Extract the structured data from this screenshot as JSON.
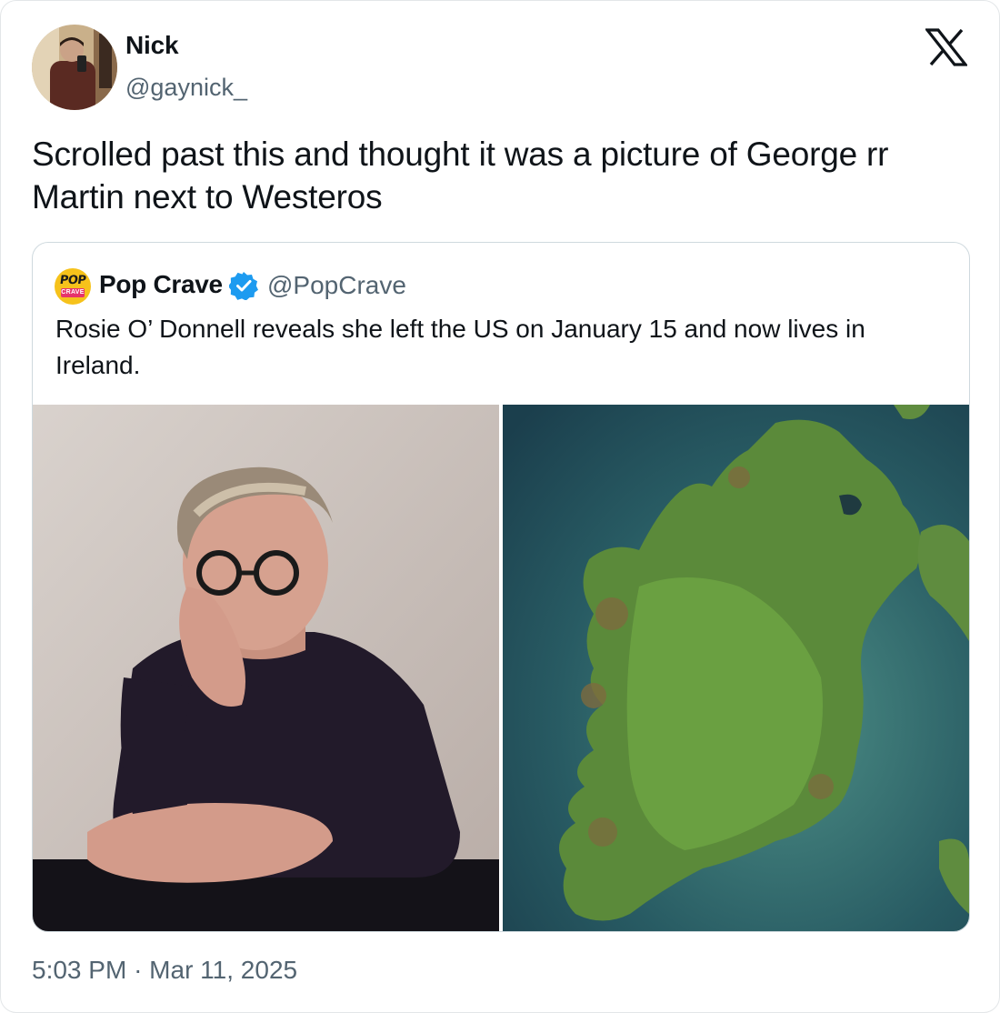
{
  "tweet": {
    "author": {
      "display_name": "Nick",
      "handle": "@gaynick_",
      "avatar_icon": "user-avatar-photo"
    },
    "platform_icon": "x-logo-icon",
    "text": "Scrolled past this and thought it was a picture of George rr Martin next to Westeros",
    "time": "5:03 PM",
    "separator": "·",
    "date": "Mar 11, 2025"
  },
  "quote": {
    "author": {
      "display_name": "Pop Crave",
      "handle": "@PopCrave",
      "verified": true,
      "avatar_logo_text_top": "POP",
      "avatar_logo_text_bottom": "CRAVE"
    },
    "text": "Rosie O’ Donnell reveals she left the US on January 15 and now lives in Ireland.",
    "media": [
      {
        "kind": "portrait-photo",
        "icon": "person-photo"
      },
      {
        "kind": "satellite-map",
        "icon": "ireland-satellite-image"
      }
    ]
  },
  "colors": {
    "primary_text": "#0f1419",
    "secondary_text": "#536471",
    "border": "#cfd9de",
    "verified_blue": "#1d9bf0",
    "popcrave_yellow": "#f6c21b",
    "popcrave_pink": "#e6346b"
  }
}
